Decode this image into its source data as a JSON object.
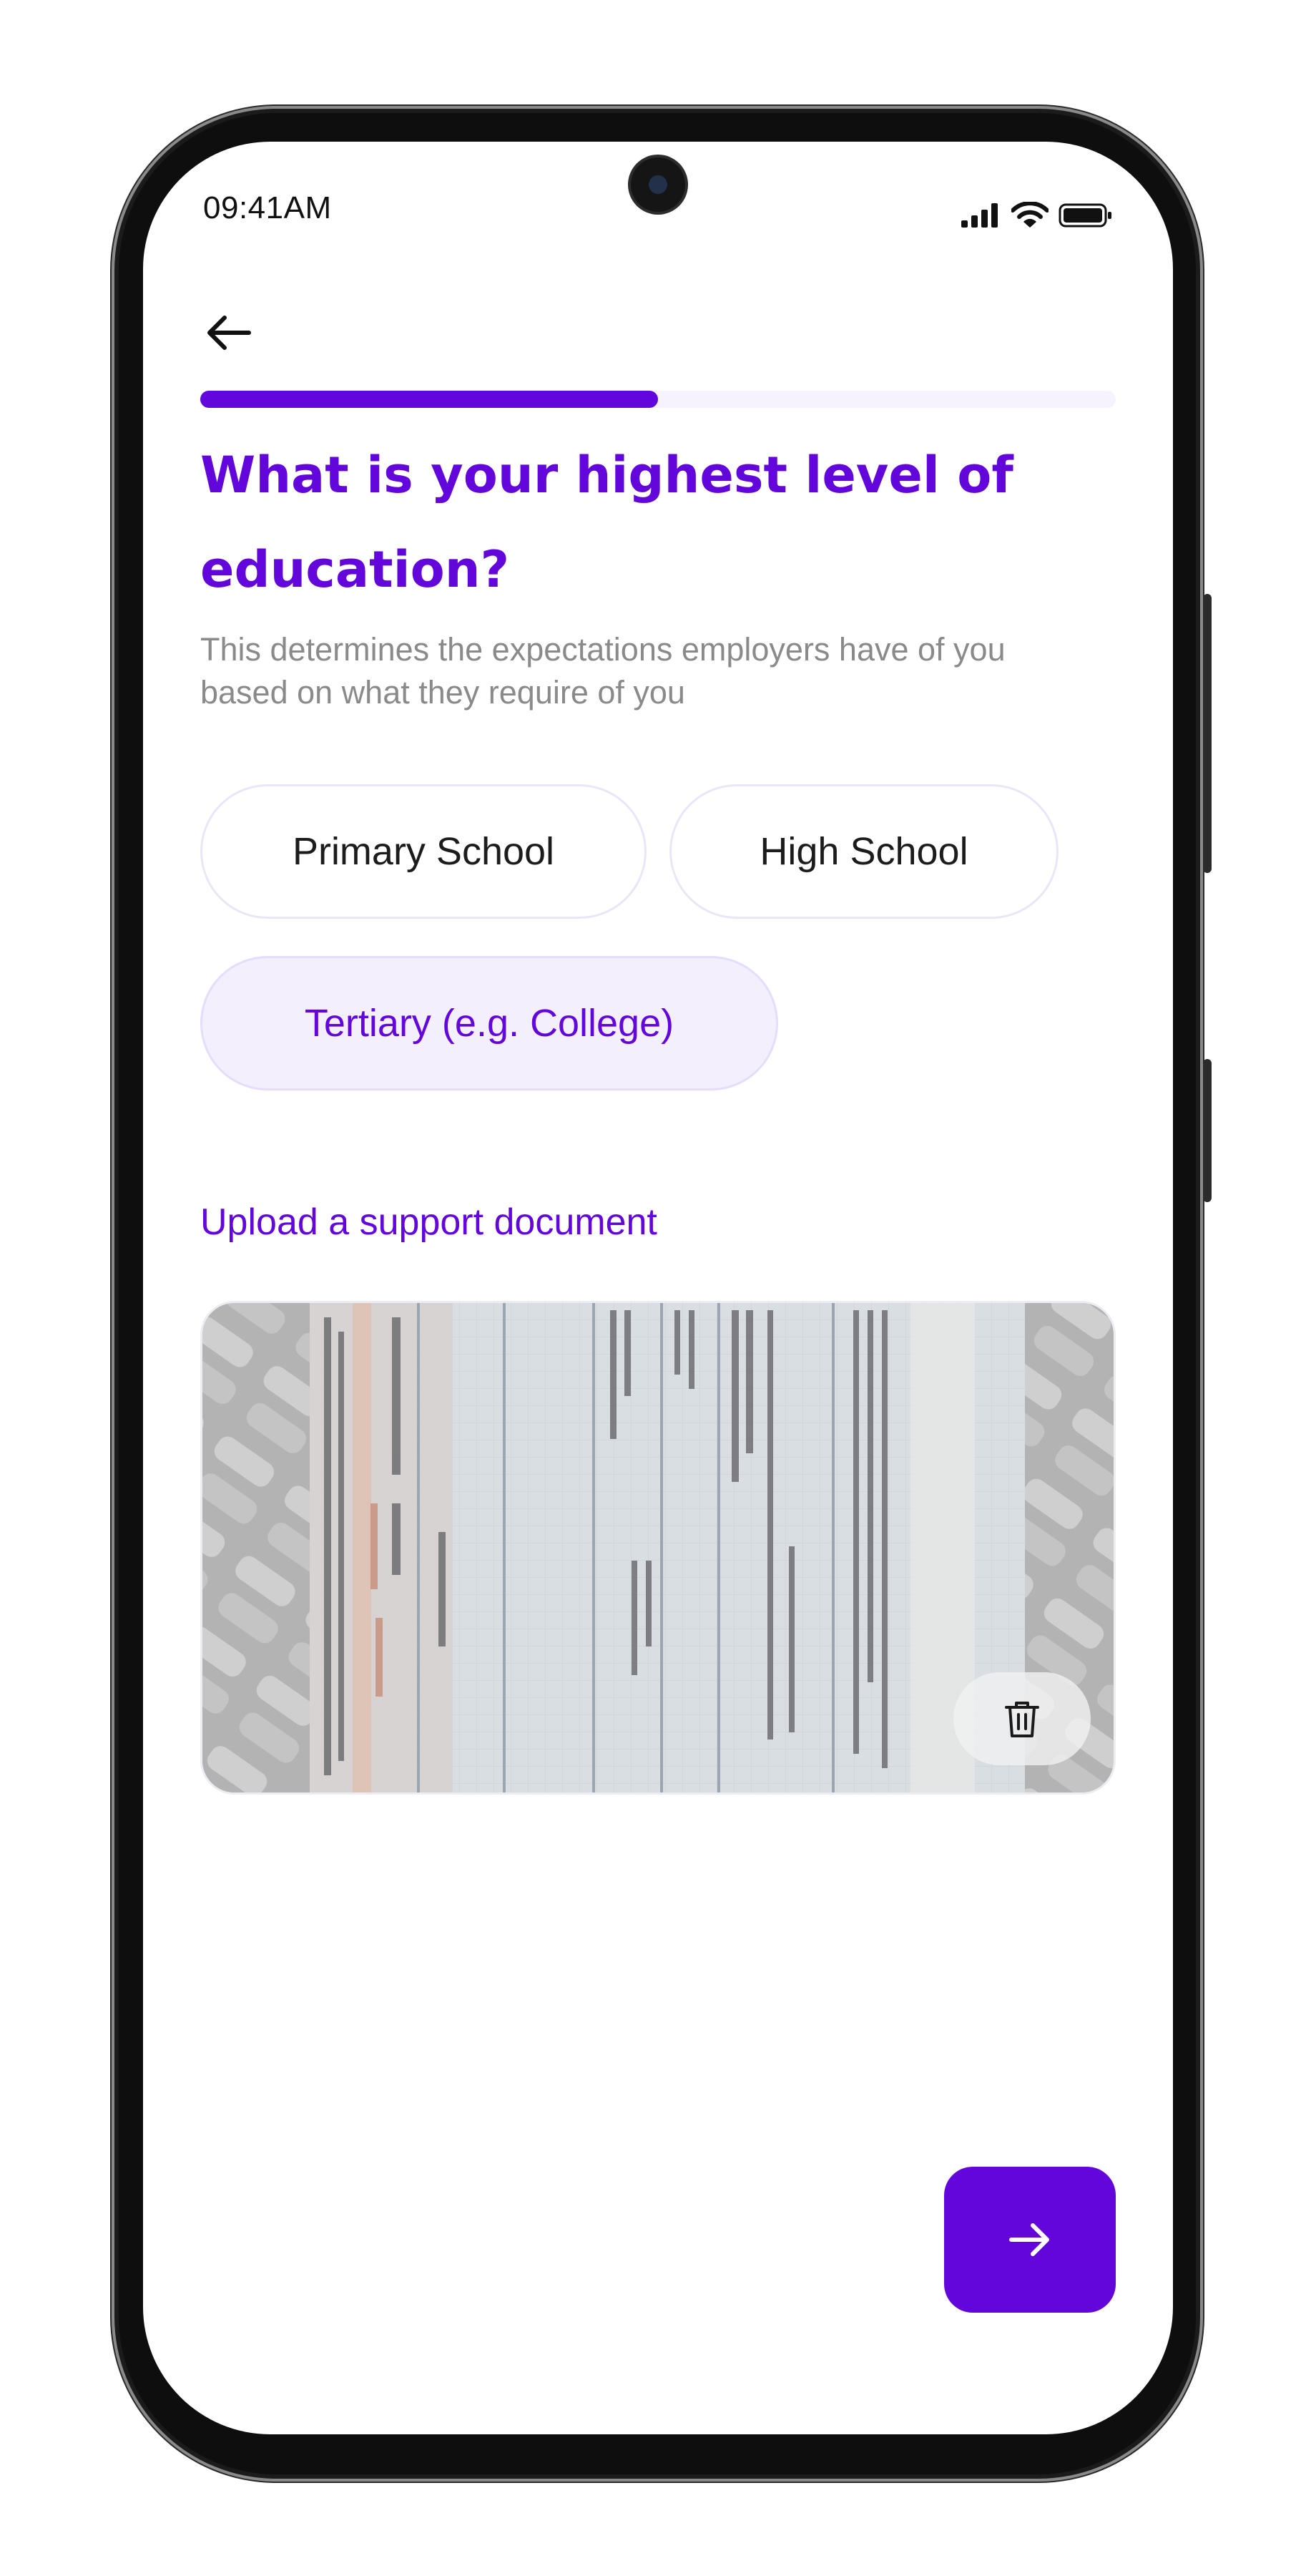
{
  "status_bar": {
    "time": "09:41AM",
    "icons": [
      "signal-icon",
      "wifi-icon",
      "battery-icon"
    ]
  },
  "navigation": {
    "back_icon": "arrow-left-icon"
  },
  "progress": {
    "fraction": 0.5
  },
  "question": {
    "title": "What is your highest level of education?",
    "subtitle": "This determines the expectations employers have of you based on what they require of you"
  },
  "options": [
    {
      "label": "Primary School",
      "selected": false
    },
    {
      "label": "High School",
      "selected": false
    },
    {
      "label": "Tertiary (e.g. College)",
      "selected": true
    }
  ],
  "upload": {
    "label": "Upload a support document",
    "delete_icon": "trash-icon"
  },
  "next_button": {
    "icon": "arrow-right-icon"
  },
  "colors": {
    "accent": "#6306db",
    "chip_selected_bg": "#f4effd",
    "progress_track": "#f6f2fe",
    "subtitle_text": "#8a8a8a"
  }
}
